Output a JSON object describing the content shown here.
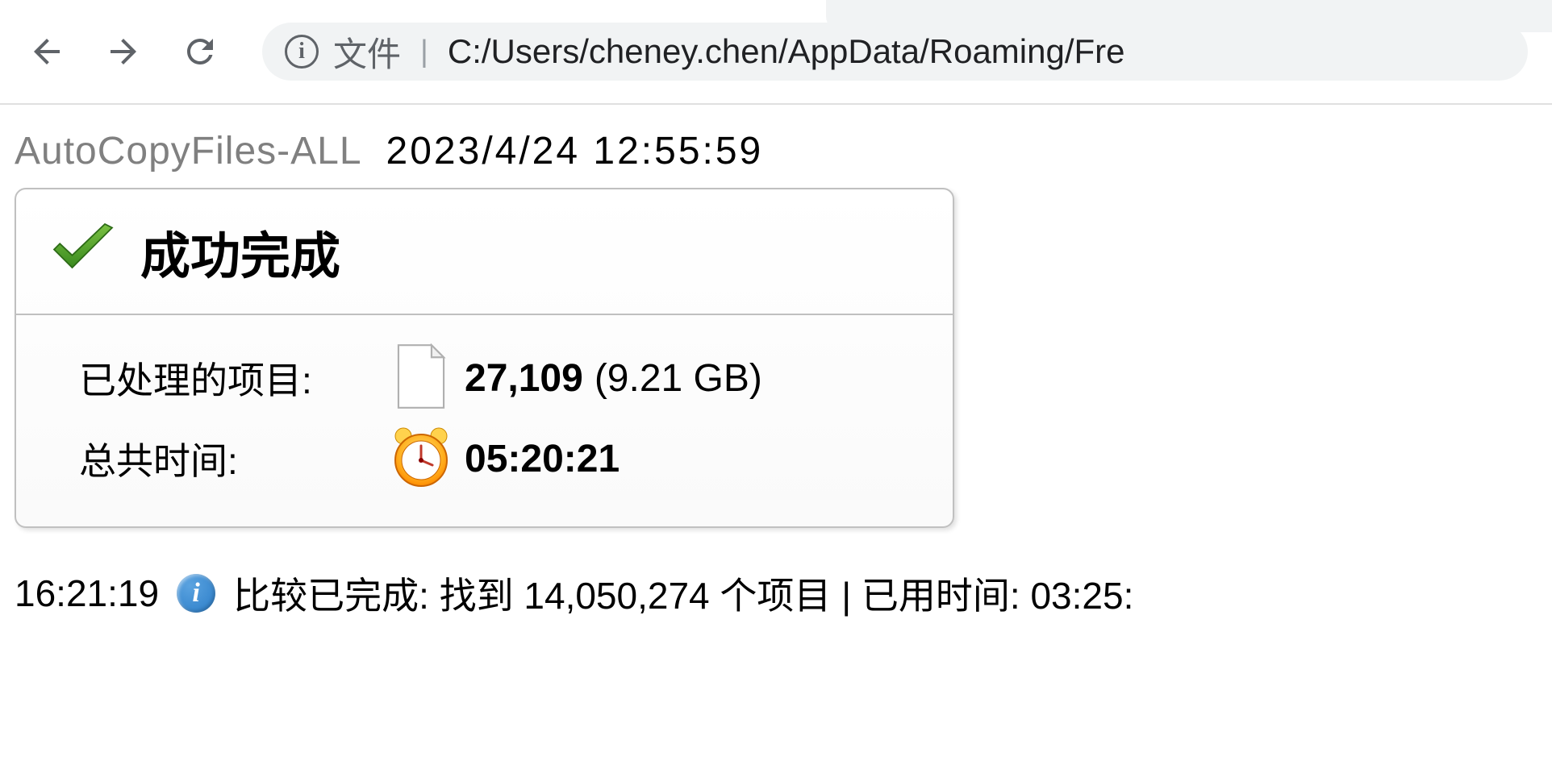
{
  "browser": {
    "url_prefix": "文件",
    "url_path": "C:/Users/cheney.chen/AppData/Roaming/Fre"
  },
  "header": {
    "job_name": "AutoCopyFiles-ALL",
    "timestamp": "2023/4/24  12:55:59"
  },
  "summary": {
    "title": "成功完成",
    "processed_label": "已处理的项目:",
    "processed_count": "27,109",
    "processed_size": "(9.21 GB)",
    "total_time_label": "总共时间:",
    "total_time_value": "05:20:21"
  },
  "log": {
    "time": "16:21:19",
    "message": "比较已完成: 找到 14,050,274 个项目 | 已用时间: 03:25:"
  }
}
